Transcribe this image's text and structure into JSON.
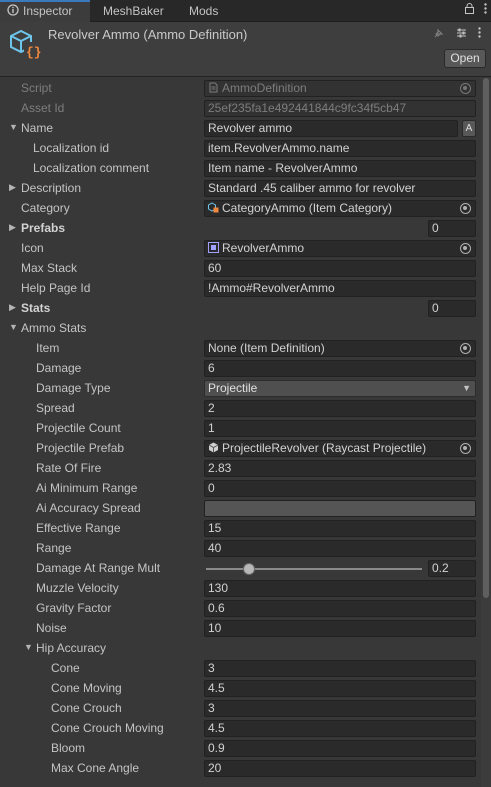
{
  "tabs": [
    {
      "label": "Inspector",
      "icon": "info-icon"
    },
    {
      "label": "MeshBaker"
    },
    {
      "label": "Mods"
    }
  ],
  "header": {
    "title": "Revolver Ammo (Ammo Definition)",
    "open_label": "Open",
    "icon": "scriptable-object-icon"
  },
  "fields": {
    "script": {
      "label": "Script",
      "value": "AmmoDefinition"
    },
    "asset_id": {
      "label": "Asset Id",
      "value": "25ef235fa1e492441844c9fc34f5cb47"
    },
    "name": {
      "label": "Name",
      "value": "Revolver ammo",
      "button": "A"
    },
    "localization_id": {
      "label": "Localization id",
      "value": "item.RevolverAmmo.name"
    },
    "localization_comment": {
      "label": "Localization comment",
      "value": "Item name - RevolverAmmo"
    },
    "description": {
      "label": "Description",
      "value": "Standard .45 caliber ammo for revolver"
    },
    "category": {
      "label": "Category",
      "value": "CategoryAmmo (Item Category)"
    },
    "prefabs": {
      "label": "Prefabs",
      "value": "0"
    },
    "icon": {
      "label": "Icon",
      "value": "RevolverAmmo"
    },
    "max_stack": {
      "label": "Max Stack",
      "value": "60"
    },
    "help_page_id": {
      "label": "Help Page Id",
      "value": "!Ammo#RevolverAmmo"
    },
    "stats": {
      "label": "Stats",
      "value": "0"
    },
    "ammo_stats": {
      "label": "Ammo Stats"
    },
    "item": {
      "label": "Item",
      "value": "None (Item Definition)"
    },
    "damage": {
      "label": "Damage",
      "value": "6"
    },
    "damage_type": {
      "label": "Damage Type",
      "value": "Projectile"
    },
    "spread": {
      "label": "Spread",
      "value": "2"
    },
    "projectile_count": {
      "label": "Projectile Count",
      "value": "1"
    },
    "projectile_prefab": {
      "label": "Projectile Prefab",
      "value": "ProjectileRevolver (Raycast Projectile)"
    },
    "rate_of_fire": {
      "label": "Rate Of Fire",
      "value": "2.83"
    },
    "ai_minimum_range": {
      "label": "Ai Minimum Range",
      "value": "0"
    },
    "ai_accuracy_spread": {
      "label": "Ai Accuracy Spread",
      "value": ""
    },
    "effective_range": {
      "label": "Effective Range",
      "value": "15"
    },
    "range": {
      "label": "Range",
      "value": "40"
    },
    "damage_at_range_mult": {
      "label": "Damage At Range Mult",
      "value": "0.2"
    },
    "muzzle_velocity": {
      "label": "Muzzle Velocity",
      "value": "130"
    },
    "gravity_factor": {
      "label": "Gravity Factor",
      "value": "0.6"
    },
    "noise": {
      "label": "Noise",
      "value": "10"
    },
    "hip_accuracy": {
      "label": "Hip Accuracy"
    },
    "cone": {
      "label": "Cone",
      "value": "3"
    },
    "cone_moving": {
      "label": "Cone Moving",
      "value": "4.5"
    },
    "cone_crouch": {
      "label": "Cone Crouch",
      "value": "3"
    },
    "cone_crouch_moving": {
      "label": "Cone Crouch Moving",
      "value": "4.5"
    },
    "bloom": {
      "label": "Bloom",
      "value": "0.9"
    },
    "max_cone_angle": {
      "label": "Max Cone Angle",
      "value": "20"
    }
  }
}
